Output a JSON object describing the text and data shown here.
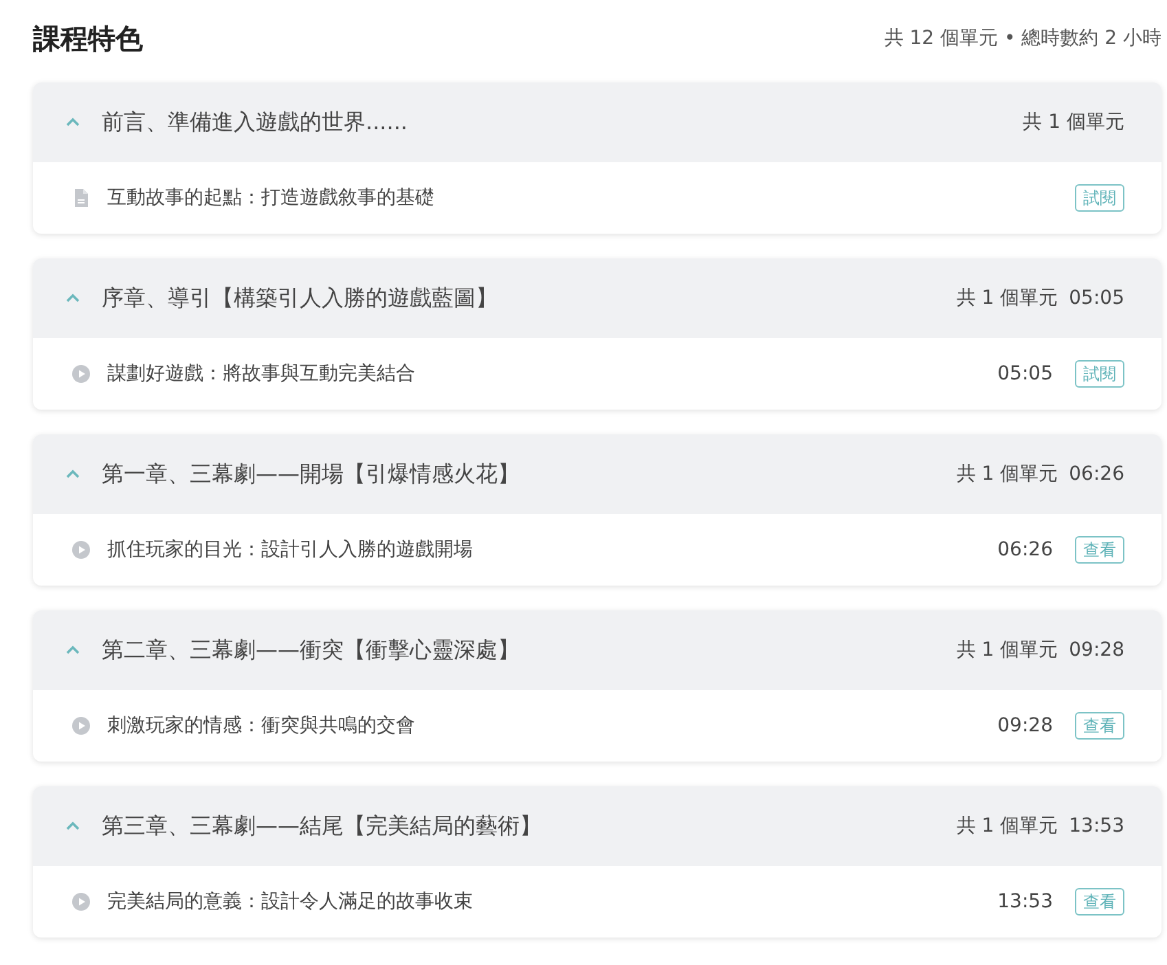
{
  "title": "課程特色",
  "summary": "共 12 個單元 • 總時數約 2 小時",
  "chapters": [
    {
      "title": "前言、準備進入遊戲的世界......",
      "units": "共 1 個單元",
      "expanded": true,
      "items": [
        {
          "kind": "document",
          "title": "互動故事的起點：打造遊戲敘事的基礎",
          "action": "試閱"
        }
      ]
    },
    {
      "title": "序章、導引【構築引人入勝的遊戲藍圖】",
      "units": "共 1 個單元",
      "duration": "05:05",
      "expanded": true,
      "items": [
        {
          "kind": "video",
          "title": "謀劃好遊戲：將故事與互動完美結合",
          "duration": "05:05",
          "action": "試閱"
        }
      ]
    },
    {
      "title": "第一章、三幕劇——開場【引爆情感火花】",
      "units": "共 1 個單元",
      "duration": "06:26",
      "expanded": true,
      "items": [
        {
          "kind": "video",
          "title": "抓住玩家的目光：設計引人入勝的遊戲開場",
          "duration": "06:26",
          "action": "查看"
        }
      ]
    },
    {
      "title": "第二章、三幕劇——衝突【衝擊心靈深處】",
      "units": "共 1 個單元",
      "duration": "09:28",
      "expanded": true,
      "items": [
        {
          "kind": "video",
          "title": "刺激玩家的情感：衝突與共鳴的交會",
          "duration": "09:28",
          "action": "查看"
        }
      ]
    },
    {
      "title": "第三章、三幕劇——結尾【完美結局的藝術】",
      "units": "共 1 個單元",
      "duration": "13:53",
      "expanded": true,
      "items": [
        {
          "kind": "video",
          "title": "完美結局的意義：設計令人滿足的故事收束",
          "duration": "13:53",
          "action": "查看"
        }
      ]
    }
  ]
}
